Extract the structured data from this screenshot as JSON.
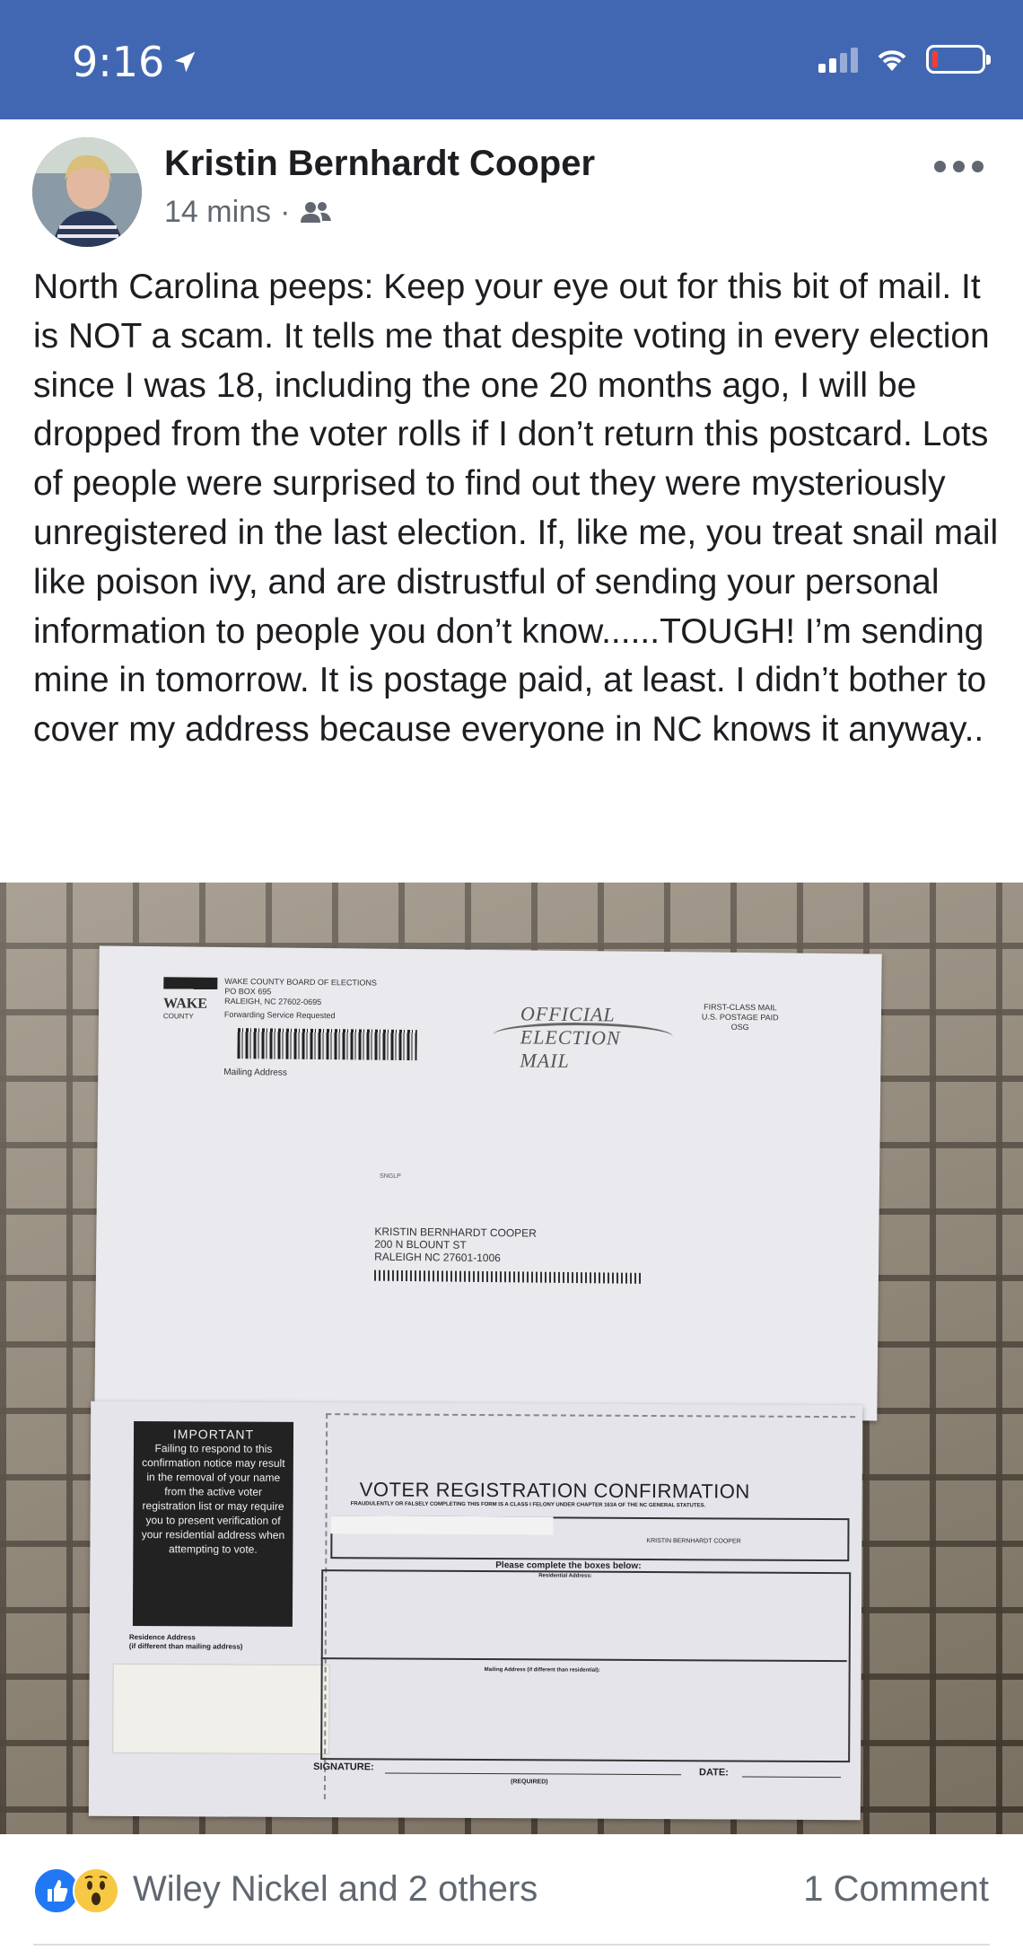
{
  "status_bar": {
    "time": "9:16",
    "icons": [
      "location-arrow-icon",
      "cellular-signal-icon",
      "wifi-icon",
      "battery-low-icon"
    ],
    "colors": {
      "background": "#4267b2",
      "battery_level": "#ff3b30"
    }
  },
  "post": {
    "author": "Kristin Bernhardt Cooper",
    "timestamp": "14 mins",
    "separator": "·",
    "audience_icon": "friends-icon",
    "more_icon": "more-options-icon",
    "text": "North Carolina peeps: Keep your eye out for this bit of mail. It is NOT a scam. It tells me that despite voting in every election since I was 18, including the one 20 months ago, I will be dropped from the voter rolls if I don’t return this postcard. Lots of people were surprised to find out they were mysteriously unregistered in the last election. If, like me, you treat snail mail like poison ivy, and are distrustful of sending your personal information to people you don’t know......TOUGH!  I’m sending mine in tomorrow. It is postage paid, at least. I didn’t bother to cover my address because everyone in NC knows it anyway.."
  },
  "photo": {
    "envelope": {
      "logo_text": "WAKE",
      "logo_sub": "COUNTY",
      "return_address": [
        "WAKE COUNTY BOARD OF ELECTIONS",
        "PO BOX 695",
        "RALEIGH, NC 27602-0695"
      ],
      "forwarding": "Forwarding Service Requested",
      "mailing_address_label": "Mailing Address",
      "official_mark": "OFFICIAL ELECTION MAIL",
      "postage": [
        "FIRST-CLASS MAIL",
        "U.S. POSTAGE PAID",
        "OSG"
      ],
      "sort_line": "SNGLP",
      "recipient": [
        "KRISTIN BERNHARDT COOPER",
        "200 N BLOUNT ST",
        "RALEIGH NC 27601-1006"
      ]
    },
    "card": {
      "important_title": "IMPORTANT",
      "important_text": "Failing to respond to this confirmation notice may result in the removal of your name from the active voter registration list or may require you to present verification of your residential address when attempting to vote.",
      "residence_label": "Residence Address",
      "residence_sub": "(if different than mailing address)",
      "title": "VOTER REGISTRATION CONFIRMATION",
      "warning": "FRAUDULENTLY OR FALSELY COMPLETING THIS FORM IS A CLASS I FELONY UNDER CHAPTER 163A OF THE NC GENERAL STATUTES.",
      "name": "KRISTIN BERNHARDT COOPER",
      "instruction": "Please complete the boxes below:",
      "residential_label": "Residential Address:",
      "mailing_label": "Mailing Address (if different than residential):",
      "signature_label": "SIGNATURE:",
      "required_label": "(REQUIRED)",
      "date_label": "DATE:"
    }
  },
  "reactions": {
    "icons": [
      "like-reaction-icon",
      "wow-reaction-icon"
    ],
    "names": "Wiley Nickel and 2 others",
    "comments": "1 Comment",
    "colors": {
      "like": "#2078f4",
      "wow": "#f7c843"
    }
  }
}
